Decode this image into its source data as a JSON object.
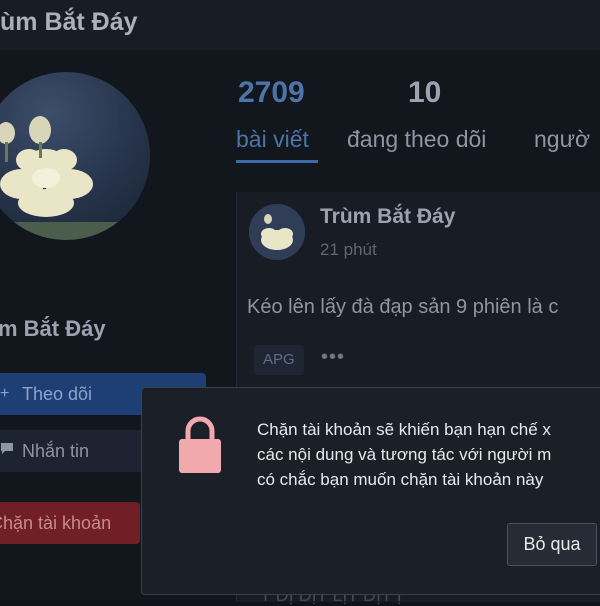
{
  "header": {
    "title": "ùm Bắt Đáy"
  },
  "profile": {
    "name": "m Bắt Đáy",
    "follow_button": "Theo dõi",
    "message_button": "Nhắn tin",
    "block_button": "Chặn tài khoản"
  },
  "stats": {
    "posts": {
      "count": "2709",
      "label": "bài viết"
    },
    "following": {
      "count": "10",
      "label": "đang theo dõi"
    },
    "followers": {
      "label": "ngườ"
    }
  },
  "post": {
    "author": "Trùm Bắt Đáy",
    "time": "21 phút",
    "text": "Kéo lên lấy đà đạp sản 9 phiên là c",
    "tag": "APG",
    "more": "•••"
  },
  "background_peek_text": "T ĐỊ ĐỊT LỊT ĐỊT Ị",
  "dialog": {
    "line1": "Chặn tài khoản sẽ khiến bạn hạn chế x",
    "line2": "các nội dung và tương tác với người m",
    "line3": "có chắc bạn muốn chặn tài khoản này",
    "cancel_button": "Bỏ qua"
  },
  "icons": {
    "follow": "plus-icon",
    "message": "chat-icon",
    "lock": "lock-icon"
  },
  "colors": {
    "background": "#0f131a",
    "accent": "#4d74a8",
    "danger": "#6f1f25",
    "lock": "#f2a9ad",
    "dialog": "#1b2028"
  }
}
